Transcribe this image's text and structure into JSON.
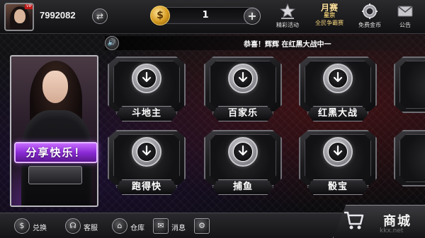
{
  "user": {
    "id": "7992082",
    "level_badge": "VIP"
  },
  "currency": {
    "coin_symbol": "$",
    "amount": "1",
    "add_symbol": "+",
    "swap_symbol": "⇄"
  },
  "top_menu": [
    {
      "label": "精彩活动",
      "icon": "star-crown-icon"
    },
    {
      "label": "全民争霸赛",
      "icon": "monthly-contest-icon",
      "title_top": "月赛",
      "title_bottom": "星宗"
    },
    {
      "label": "免费金币",
      "icon": "gear-coin-icon"
    },
    {
      "label": "公告",
      "icon": "mail-icon"
    }
  ],
  "announcement": {
    "speaker_icon": "🔊",
    "message": "恭喜！辉辉 在红黑大战中一"
  },
  "promo": {
    "share_label": "分享快乐！"
  },
  "games": [
    {
      "name": "斗地主"
    },
    {
      "name": "百家乐"
    },
    {
      "name": "红黑大战"
    },
    {
      "name": "跑得快"
    },
    {
      "name": "捕鱼"
    },
    {
      "name": "骰宝"
    }
  ],
  "bottom_menu": [
    {
      "label": "兑换",
      "icon": "money-bag-icon"
    },
    {
      "label": "客服",
      "icon": "headset-icon"
    },
    {
      "label": "仓库",
      "icon": "warehouse-icon"
    },
    {
      "label": "消息",
      "icon": "message-icon"
    },
    {
      "label": "",
      "icon": "settings-icon"
    }
  ],
  "shop": {
    "label": "商城"
  },
  "watermark": "kkx.net"
}
